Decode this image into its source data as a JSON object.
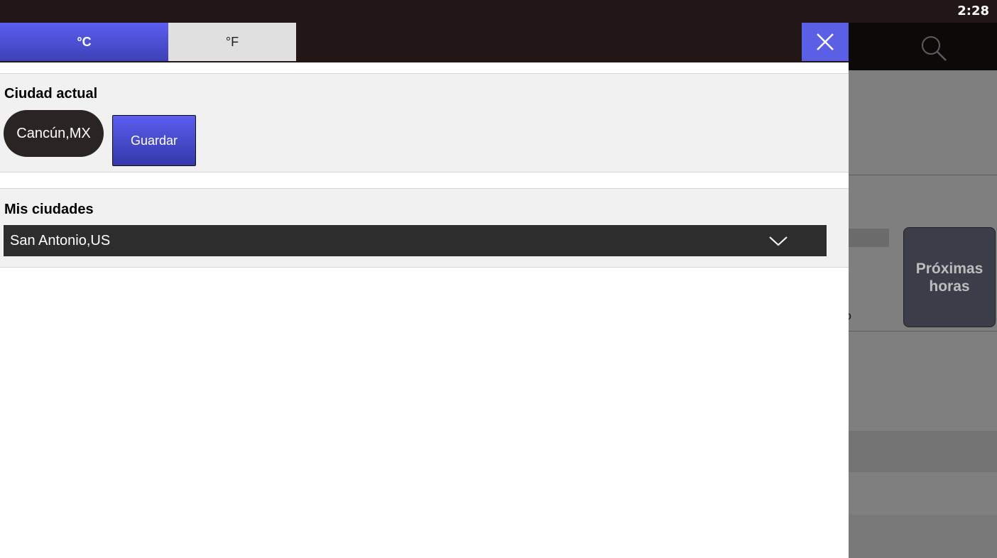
{
  "status_bar": {
    "time": "2:28"
  },
  "background": {
    "next_hours_button": "Próximas horas",
    "degree_fragment": "o"
  },
  "drawer": {
    "units": {
      "celsius": "°C",
      "fahrenheit": "°F",
      "selected": "°C"
    },
    "current_city": {
      "title": "Ciudad actual",
      "city": "Cancún,MX",
      "save_label": "Guardar"
    },
    "my_cities": {
      "title": "Mis ciudades",
      "selected_city": "San Antonio,US"
    }
  },
  "colors": {
    "accent": "#5b5ef0",
    "accent_dark": "#3538a8",
    "status_bar": "#231616",
    "pill": "#2a2522",
    "select": "#2d2d2d"
  },
  "icons": {
    "close": "close-icon",
    "search": "search-icon",
    "dropdown": "chevron-down-icon"
  }
}
